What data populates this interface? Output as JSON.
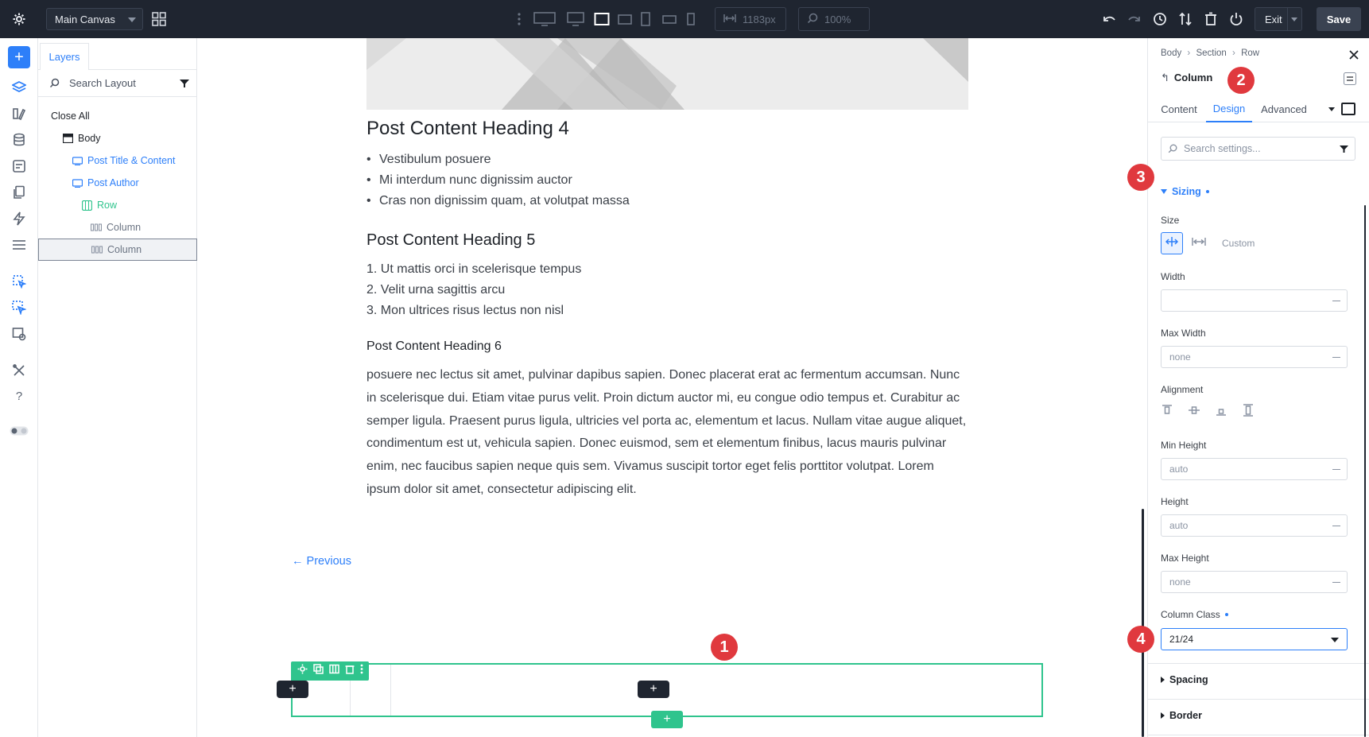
{
  "topbar": {
    "canvas_name": "Main Canvas",
    "width_value": "1183px",
    "zoom_value": "100%",
    "exit_label": "Exit",
    "save_label": "Save"
  },
  "layers": {
    "tab_label": "Layers",
    "search_placeholder": "Search Layout",
    "close_all": "Close All",
    "items": [
      {
        "label": "Body"
      },
      {
        "label": "Post Title & Content"
      },
      {
        "label": "Post Author"
      },
      {
        "label": "Row"
      },
      {
        "label": "Column"
      },
      {
        "label": "Column"
      }
    ]
  },
  "content": {
    "heading4": "Post Content Heading 4",
    "bullets": [
      "Vestibulum posuere",
      "Mi interdum nunc dignissim auctor",
      "Cras non dignissim quam, at volutpat massa"
    ],
    "heading5": "Post Content Heading 5",
    "numbered": [
      "1. Ut mattis orci in scelerisque tempus",
      "2. Velit urna sagittis arcu",
      "3. Mon ultrices risus lectus non nisl"
    ],
    "heading6": "Post Content Heading 6",
    "paragraph": "posuere nec lectus sit amet, pulvinar dapibus sapien. Donec placerat erat ac fermentum accumsan. Nunc in scelerisque dui. Etiam vitae purus velit. Proin dictum auctor mi, eu congue odio tempus et. Curabitur ac semper ligula. Praesent purus ligula, ultricies vel porta ac, elementum et lacus. Nullam vitae augue aliquet, condimentum est ut, vehicula sapien. Donec euismod, sem et elementum finibus, lacus mauris pulvinar enim, nec faucibus sapien neque quis sem. Vivamus suscipit tortor eget felis porttitor volutpat. Lorem ipsum dolor sit amet, consectetur adipiscing elit.",
    "previous_link": "← Previous",
    "plus": "+"
  },
  "badges": [
    "1",
    "2",
    "3",
    "4"
  ],
  "panel": {
    "breadcrumb": [
      "Body",
      "Section",
      "Row"
    ],
    "title": "Column",
    "tabs": [
      "Content",
      "Design",
      "Advanced"
    ],
    "active_tab": "Design",
    "search_placeholder": "Search settings...",
    "sizing_label": "Sizing",
    "size_label": "Size",
    "custom_label": "Custom",
    "width_label": "Width",
    "width_value": "",
    "max_width_label": "Max Width",
    "max_width_value": "none",
    "alignment_label": "Alignment",
    "min_height_label": "Min Height",
    "min_height_value": "auto",
    "height_label": "Height",
    "height_value": "auto",
    "max_height_label": "Max Height",
    "max_height_value": "none",
    "column_class_label": "Column Class",
    "column_class_value": "21/24",
    "spacing_label": "Spacing",
    "border_label": "Border"
  },
  "colors": {
    "accent": "#2d7ff9",
    "row_green": "#2fc48d",
    "badge_red": "#e0393e",
    "topbar": "#1f2530"
  }
}
